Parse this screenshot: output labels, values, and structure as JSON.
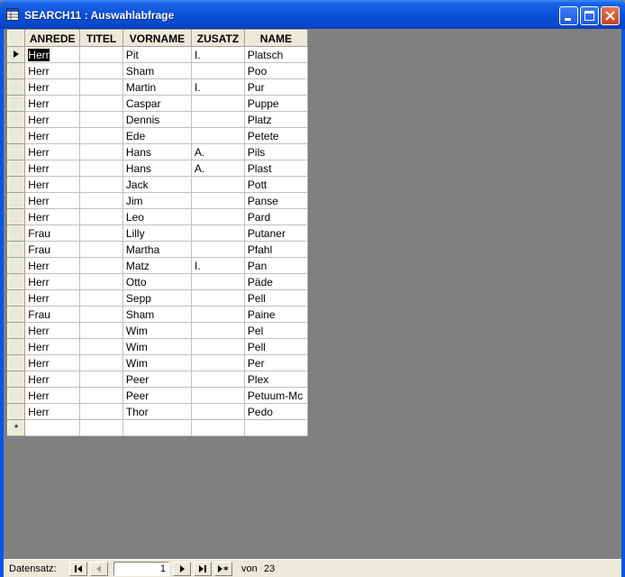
{
  "window": {
    "title": "SEARCH11 : Auswahlabfrage"
  },
  "grid": {
    "columns": [
      "ANREDE",
      "TITEL",
      "VORNAME",
      "ZUSATZ",
      "NAME"
    ],
    "rows": [
      {
        "ANREDE": "Herr",
        "TITEL": "",
        "VORNAME": "Pit",
        "ZUSATZ": "I.",
        "NAME": "Platsch"
      },
      {
        "ANREDE": "Herr",
        "TITEL": "",
        "VORNAME": "Sham",
        "ZUSATZ": "",
        "NAME": "Poo"
      },
      {
        "ANREDE": "Herr",
        "TITEL": "",
        "VORNAME": "Martin",
        "ZUSATZ": "I.",
        "NAME": "Pur"
      },
      {
        "ANREDE": "Herr",
        "TITEL": "",
        "VORNAME": "Caspar",
        "ZUSATZ": "",
        "NAME": "Puppe"
      },
      {
        "ANREDE": "Herr",
        "TITEL": "",
        "VORNAME": "Dennis",
        "ZUSATZ": "",
        "NAME": "Platz"
      },
      {
        "ANREDE": "Herr",
        "TITEL": "",
        "VORNAME": "Ede",
        "ZUSATZ": "",
        "NAME": "Petete"
      },
      {
        "ANREDE": "Herr",
        "TITEL": "",
        "VORNAME": "Hans",
        "ZUSATZ": "A.",
        "NAME": "Pils"
      },
      {
        "ANREDE": "Herr",
        "TITEL": "",
        "VORNAME": "Hans",
        "ZUSATZ": "A.",
        "NAME": "Plast"
      },
      {
        "ANREDE": "Herr",
        "TITEL": "",
        "VORNAME": "Jack",
        "ZUSATZ": "",
        "NAME": "Pott"
      },
      {
        "ANREDE": "Herr",
        "TITEL": "",
        "VORNAME": "Jim",
        "ZUSATZ": "",
        "NAME": "Panse"
      },
      {
        "ANREDE": "Herr",
        "TITEL": "",
        "VORNAME": "Leo",
        "ZUSATZ": "",
        "NAME": "Pard"
      },
      {
        "ANREDE": "Frau",
        "TITEL": "",
        "VORNAME": "Lilly",
        "ZUSATZ": "",
        "NAME": "Putaner"
      },
      {
        "ANREDE": "Frau",
        "TITEL": "",
        "VORNAME": "Martha",
        "ZUSATZ": "",
        "NAME": "Pfahl"
      },
      {
        "ANREDE": "Herr",
        "TITEL": "",
        "VORNAME": "Matz",
        "ZUSATZ": "I.",
        "NAME": "Pan"
      },
      {
        "ANREDE": "Herr",
        "TITEL": "",
        "VORNAME": "Otto",
        "ZUSATZ": "",
        "NAME": "Päde"
      },
      {
        "ANREDE": "Herr",
        "TITEL": "",
        "VORNAME": "Sepp",
        "ZUSATZ": "",
        "NAME": "Pell"
      },
      {
        "ANREDE": "Frau",
        "TITEL": "",
        "VORNAME": "Sham",
        "ZUSATZ": "",
        "NAME": "Paine"
      },
      {
        "ANREDE": "Herr",
        "TITEL": "",
        "VORNAME": "Wim",
        "ZUSATZ": "",
        "NAME": "Pel"
      },
      {
        "ANREDE": "Herr",
        "TITEL": "",
        "VORNAME": "Wim",
        "ZUSATZ": "",
        "NAME": "Pell"
      },
      {
        "ANREDE": "Herr",
        "TITEL": "",
        "VORNAME": "Wim",
        "ZUSATZ": "",
        "NAME": "Per"
      },
      {
        "ANREDE": "Herr",
        "TITEL": "",
        "VORNAME": "Peer",
        "ZUSATZ": "",
        "NAME": "Plex"
      },
      {
        "ANREDE": "Herr",
        "TITEL": "",
        "VORNAME": "Peer",
        "ZUSATZ": "",
        "NAME": "Petuum-Mc"
      },
      {
        "ANREDE": "Herr",
        "TITEL": "",
        "VORNAME": "Thor",
        "ZUSATZ": "",
        "NAME": "Pedo"
      }
    ],
    "current_row_marker": "▶",
    "new_row_marker": "*"
  },
  "navigation": {
    "label": "Datensatz:",
    "current_record": "1",
    "of_label": "von",
    "total_records": "23"
  },
  "icons": {
    "app": "table-icon",
    "minimize": "minimize-icon",
    "maximize": "maximize-icon",
    "close": "close-icon",
    "first": "first-record-icon",
    "prev": "previous-record-icon",
    "next": "next-record-icon",
    "last": "last-record-icon",
    "new": "new-record-icon"
  },
  "colors": {
    "titlebar": "#0a4fd8",
    "background": "#808080",
    "chrome": "#ece9d8"
  }
}
